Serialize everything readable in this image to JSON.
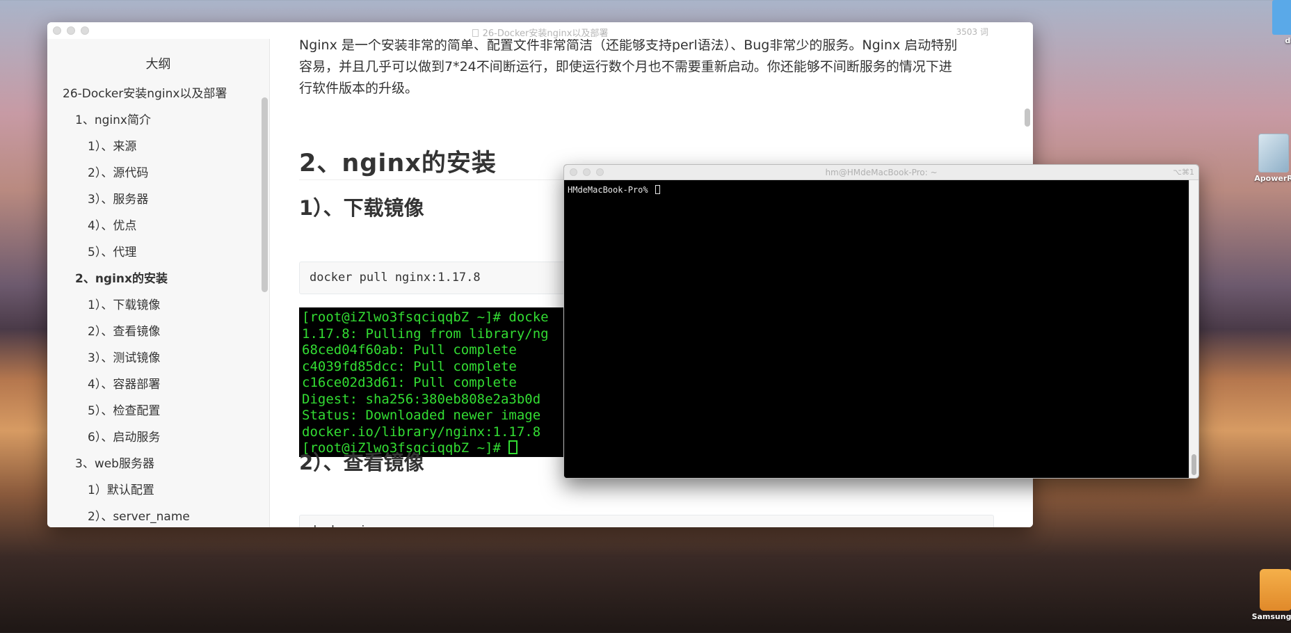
{
  "desktop": {
    "icons": [
      {
        "name": "folder",
        "label": "da"
      },
      {
        "name": "app",
        "label": "ApowerR"
      },
      {
        "name": "drive",
        "label": "Samsung"
      }
    ]
  },
  "typora": {
    "title": "26-Docker安装nginx以及部署",
    "word_count": "3503 词",
    "outline_title": "大纲",
    "outline": [
      {
        "label": "26-Docker安装nginx以及部署",
        "level": 1,
        "active": false
      },
      {
        "label": "1、nginx简介",
        "level": 2,
        "active": false
      },
      {
        "label": "1）、来源",
        "level": 3,
        "active": false
      },
      {
        "label": "2）、源代码",
        "level": 3,
        "active": false
      },
      {
        "label": "3）、服务器",
        "level": 3,
        "active": false
      },
      {
        "label": "4）、优点",
        "level": 3,
        "active": false
      },
      {
        "label": "5）、代理",
        "level": 3,
        "active": false
      },
      {
        "label": "2、nginx的安装",
        "level": 2,
        "active": true
      },
      {
        "label": "1）、下载镜像",
        "level": 3,
        "active": false
      },
      {
        "label": "2）、查看镜像",
        "level": 3,
        "active": false
      },
      {
        "label": "3）、测试镜像",
        "level": 3,
        "active": false
      },
      {
        "label": "4）、容器部署",
        "level": 3,
        "active": false
      },
      {
        "label": "5）、检查配置",
        "level": 3,
        "active": false
      },
      {
        "label": "6）、启动服务",
        "level": 3,
        "active": false
      },
      {
        "label": "3、web服务器",
        "level": 2,
        "active": false
      },
      {
        "label": "1）默认配置",
        "level": 3,
        "active": false
      },
      {
        "label": "2）、server_name",
        "level": 3,
        "active": false
      }
    ],
    "content": {
      "para_line1": "Nginx 是一个安装非常的简单、配置文件非常简洁（还能够支持perl语法）、Bug非常少的服务。Nginx 启动特别",
      "para_line2": "容易，并且几乎可以做到7*24不间断运行，即使运行数个月也不需要重新启动。你还能够不间断服务的情况下进",
      "para_line3": "行软件版本的升级。",
      "h2": "2、nginx的安装",
      "h3_download": "1）、下载镜像",
      "code_pull": "docker pull nginx:1.17.8",
      "terminal_image_lines": [
        "[root@iZlwo3fsqciqqbZ ~]# docke",
        "1.17.8: Pulling from library/ng",
        "68ced04f60ab: Pull complete",
        "c4039fd85dcc: Pull complete",
        "c16ce02d3d61: Pull complete",
        "Digest: sha256:380eb808e2a3b0d",
        "Status: Downloaded newer image",
        "docker.io/library/nginx:1.17.8",
        "[root@iZlwo3fsqciqqbZ ~]# "
      ],
      "h3_view": "2）、查看镜像",
      "code_images": "docker images"
    }
  },
  "terminal": {
    "title": "hm@HMdeMacBook-Pro: ~",
    "shortcut": "⌥⌘1",
    "prompt": "HMdeMacBook-Pro% "
  },
  "colors": {
    "terminal_green": "#33dd33",
    "editor_text": "#333333"
  }
}
